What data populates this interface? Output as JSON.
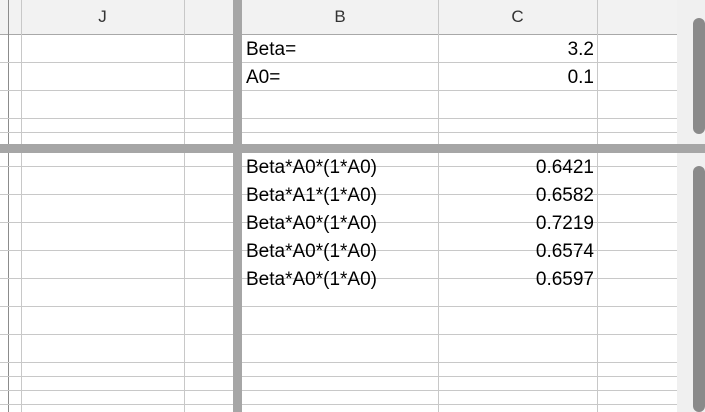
{
  "columns": {
    "j": "J",
    "b": "B",
    "c": "C"
  },
  "top_rows": [
    {
      "label": "Beta=",
      "value": "3.2"
    },
    {
      "label": "A0=",
      "value": "0.1"
    }
  ],
  "bottom_rows": [
    {
      "label": "Beta*A0*(1*A0)",
      "value": "0.6421"
    },
    {
      "label": "Beta*A1*(1*A0)",
      "value": "0.6582"
    },
    {
      "label": "Beta*A0*(1*A0)",
      "value": "0.7219"
    },
    {
      "label": "Beta*A0*(1*A0)",
      "value": "0.6574"
    },
    {
      "label": "Beta*A0*(1*A0)",
      "value": "0.6597"
    }
  ]
}
